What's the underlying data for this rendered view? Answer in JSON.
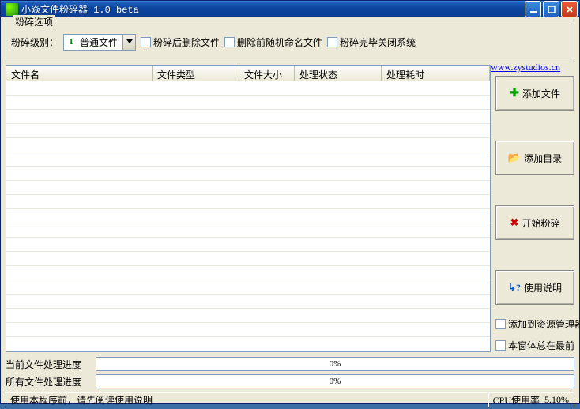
{
  "titlebar": {
    "title": "小焱文件粉碎器  1.0 beta"
  },
  "groupbox": {
    "legend": "粉碎选项",
    "level_label": "粉碎级别：",
    "level_value": "普通文件",
    "cb_delete_after": "粉碎后删除文件",
    "cb_rename_before": "删除前随机命名文件",
    "cb_shutdown_after": "粉碎完毕关闭系统"
  },
  "link": "www.zystudios.cn",
  "columns": {
    "c0": "文件名",
    "c1": "文件类型",
    "c2": "文件大小",
    "c3": "处理状态",
    "c4": "处理耗时"
  },
  "buttons": {
    "add_file": "添加文件",
    "add_dir": "添加目录",
    "start": "开始粉碎",
    "help": "使用说明"
  },
  "side_checks": {
    "add_explorer": "添加到资源管理器",
    "always_top": "本窗体总在最前"
  },
  "progress": {
    "current_label": "当前文件处理进度",
    "all_label": "所有文件处理进度",
    "current_pct": "0%",
    "all_pct": "0%"
  },
  "status": {
    "hint": "使用本程序前，请先阅读使用说明",
    "cpu_label": "CPU使用率",
    "cpu_value": "5.10%"
  }
}
